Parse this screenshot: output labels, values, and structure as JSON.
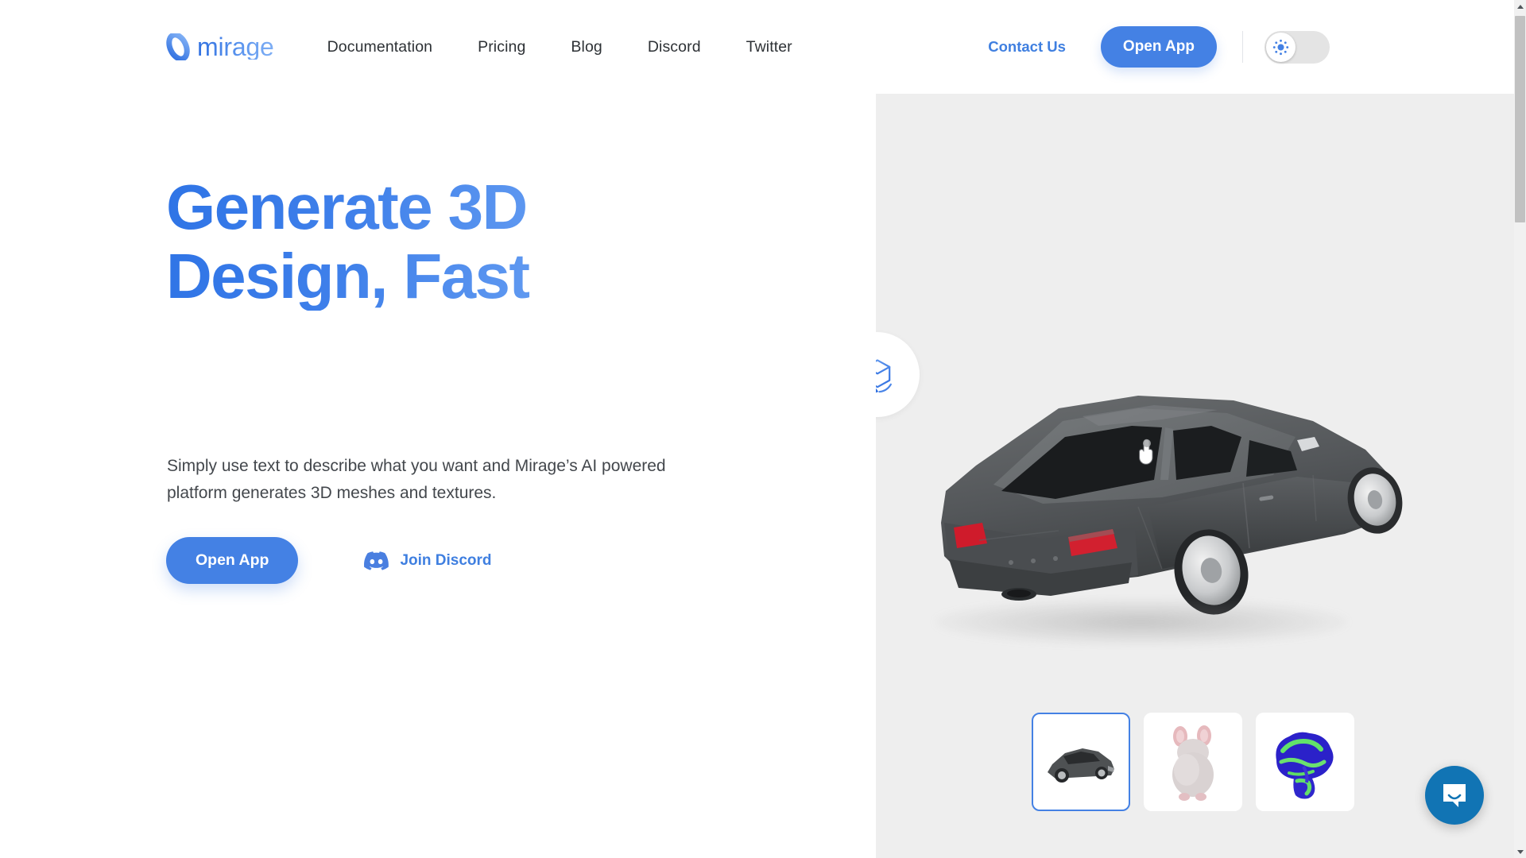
{
  "brand": {
    "name": "mirage",
    "logo_icon": "mirage-ring-logo",
    "gradient_from": "#2f6fe0",
    "gradient_to": "#82b1f5"
  },
  "nav": {
    "links": [
      {
        "label": "Documentation"
      },
      {
        "label": "Pricing"
      },
      {
        "label": "Blog"
      },
      {
        "label": "Discord"
      },
      {
        "label": "Twitter"
      }
    ],
    "contact_label": "Contact Us",
    "open_app_label": "Open App",
    "theme_toggle": {
      "icon": "sun-icon",
      "state": "light",
      "knob_position": "left"
    }
  },
  "hero": {
    "headline_line1": "Generate 3D",
    "headline_line2": "Design, Fast",
    "subhead": "Simply use text to describe what you want and Mirage’s AI powered platform  generates 3D meshes and textures.",
    "primary_cta": "Open App",
    "secondary_cta": "Join Discord",
    "secondary_cta_icon": "discord-icon"
  },
  "viewer": {
    "badge_icon": "rotate-3d-cube-icon",
    "background_color": "#eeeeee",
    "cursor_icon": "pointing-hand-cursor",
    "model": {
      "name": "car",
      "body_color": "#55585a",
      "glass_color": "#1c1e20",
      "taillight_color": "#d8182a",
      "wheel_color": "#d6d8da"
    },
    "thumbnails": [
      {
        "name": "car",
        "selected": true
      },
      {
        "name": "mouse",
        "selected": false
      },
      {
        "name": "brain",
        "selected": false
      }
    ]
  },
  "chat": {
    "icon": "intercom-chat-bubble-icon",
    "color": "#1174b4"
  },
  "scrollbar": {
    "up_arrow": "scroll-up-arrow",
    "down_arrow": "scroll-down-arrow",
    "thumb_color": "#c1c1c1"
  },
  "colors": {
    "accent_blue": "#4481e4",
    "link_blue": "#3f7fe0",
    "nav_text": "#2d3135",
    "body_text": "#43474c",
    "panel_bg": "#eeeeee"
  }
}
